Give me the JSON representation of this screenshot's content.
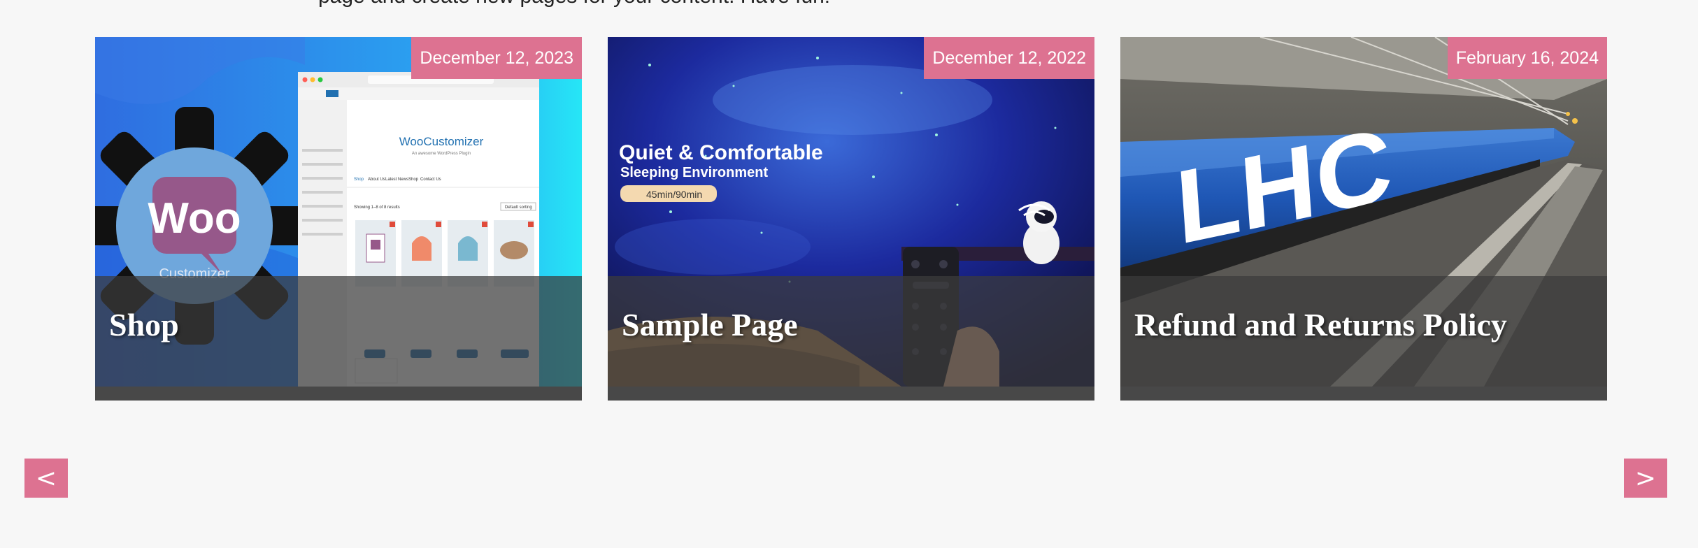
{
  "intro": {
    "text": "page and create new pages for your content. Have fun!"
  },
  "colors": {
    "accent": "#dd7291",
    "background": "#f7f7f7",
    "overlay": "#3c3c3c"
  },
  "cards": [
    {
      "title": "Shop",
      "date": "December 12, 2023",
      "image": {
        "logo": "Woo",
        "logo_sub": "Customizer",
        "window_title": "WooCustomizer",
        "window_subtitle": "An awesome WordPress Plugin",
        "nav_links": [
          "Shop",
          "About Us",
          "Latest News",
          "Shop",
          "Contact Us"
        ],
        "result_text": "Showing 1–8 of 8 results",
        "sort_label": "Default sorting"
      }
    },
    {
      "title": "Sample Page",
      "date": "December 12, 2022",
      "image": {
        "headline": "Quiet & Comfortable",
        "subline": "Sleeping Environment",
        "badge": "45min/90min"
      }
    },
    {
      "title": "Refund and Returns Policy",
      "date": "February 16, 2024",
      "image": {
        "painted_text": "LHC"
      }
    }
  ],
  "nav": {
    "prev_label": "<",
    "next_label": ">"
  }
}
